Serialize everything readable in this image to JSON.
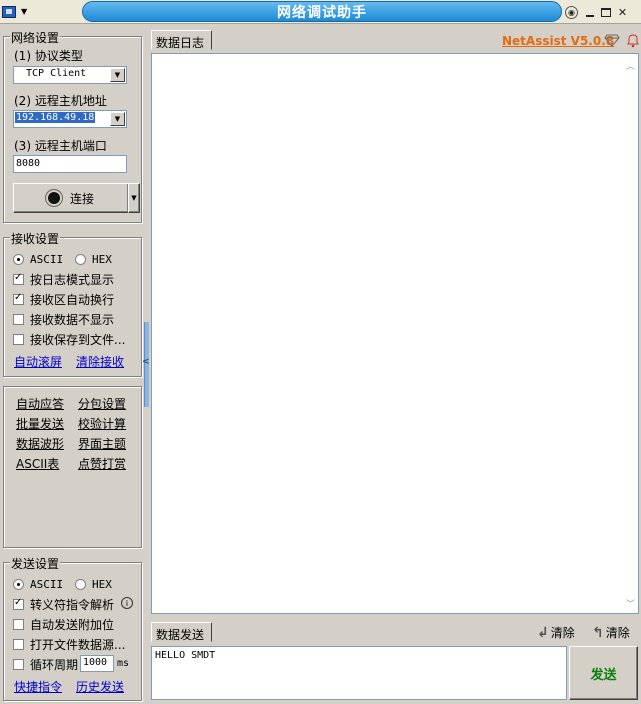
{
  "title": "网络调试助手",
  "brand": {
    "label": "NetAssist V5.0.8",
    "color": "#e36b12"
  },
  "network": {
    "group_title": "网络设置",
    "protocol_label": "(1) 协议类型",
    "protocol_value": "TCP Client",
    "host_label": "(2) 远程主机地址",
    "host_value": "192.168.49.18",
    "port_label": "(3) 远程主机端口",
    "port_value": "8080",
    "connect_label": "连接"
  },
  "receive": {
    "group_title": "接收设置",
    "mode_ascii": "ASCII",
    "mode_hex": "HEX",
    "options": [
      {
        "label": "按日志模式显示",
        "checked": true
      },
      {
        "label": "接收区自动换行",
        "checked": true
      },
      {
        "label": "接收数据不显示",
        "checked": false
      },
      {
        "label": "接收保存到文件...",
        "checked": false
      }
    ],
    "auto_scroll": "自动滚屏",
    "clear_receive": "清除接收"
  },
  "tools": {
    "items": [
      "自动应答",
      "分包设置",
      "批量发送",
      "校验计算",
      "数据波形",
      "界面主题",
      "ASCII表",
      "点赞打赏"
    ]
  },
  "send": {
    "group_title": "发送设置",
    "mode_ascii": "ASCII",
    "mode_hex": "HEX",
    "options": [
      {
        "label": "转义符指令解析",
        "checked": true
      },
      {
        "label": "自动发送附加位",
        "checked": false
      },
      {
        "label": "打开文件数据源...",
        "checked": false
      },
      {
        "label": "循环周期",
        "checked": false
      }
    ],
    "cycle_value": "1000",
    "cycle_unit": "ms",
    "shortcut": "快捷指令",
    "history": "历史发送"
  },
  "log": {
    "tab_label": "数据日志"
  },
  "send_area": {
    "tab_label": "数据发送",
    "clear1": "清除",
    "clear2": "清除",
    "content": "HELLO SMDT",
    "send_button": "发送"
  }
}
